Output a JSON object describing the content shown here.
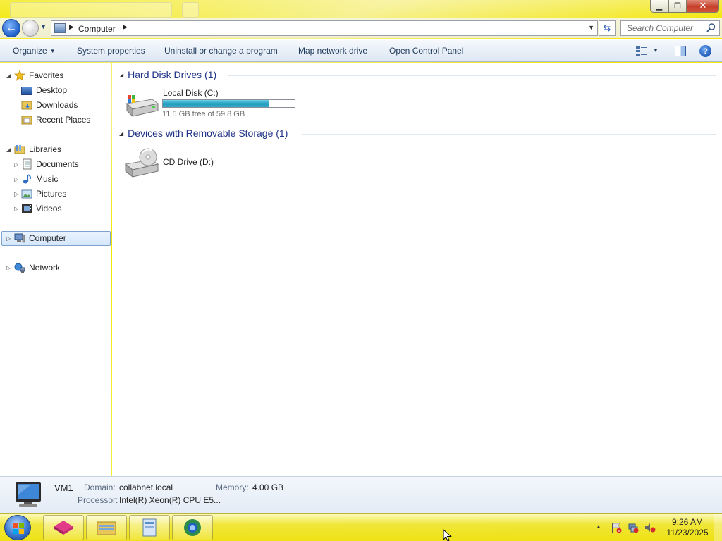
{
  "window": {
    "controls": {
      "minimize": "▁",
      "maximize": "❐",
      "close": "✕"
    }
  },
  "address": {
    "crumb": "Computer",
    "search_placeholder": "Search Computer"
  },
  "toolbar": {
    "organize": "Organize",
    "system_properties": "System properties",
    "uninstall": "Uninstall or change a program",
    "map_drive": "Map network drive",
    "control_panel": "Open Control Panel",
    "help": "?"
  },
  "nav": {
    "favorites": "Favorites",
    "desktop": "Desktop",
    "downloads": "Downloads",
    "recent_places": "Recent Places",
    "libraries": "Libraries",
    "documents": "Documents",
    "music": "Music",
    "pictures": "Pictures",
    "videos": "Videos",
    "computer": "Computer",
    "network": "Network"
  },
  "groups": {
    "hdd_header": "Hard Disk Drives (1)",
    "removable_header": "Devices with Removable Storage (1)"
  },
  "drives": {
    "c_name": "Local Disk (C:)",
    "c_free": "11.5 GB free of 59.8 GB",
    "c_used_fraction": 0.808,
    "d_name": "CD Drive (D:)"
  },
  "details": {
    "computer_name": "VM1",
    "domain_label": "Domain:",
    "domain_value": "collabnet.local",
    "memory_label": "Memory:",
    "memory_value": "4.00 GB",
    "processor_label": "Processor:",
    "processor_value": "Intel(R) Xeon(R) CPU E5..."
  },
  "taskbar": {
    "time": "9:26 AM",
    "date": "11/23/2025"
  },
  "colors": {
    "desktop": "#f2e600",
    "group_header": "#1e3287",
    "drive_bar": "#1f9bbd",
    "selection": "#d4e7fc"
  }
}
